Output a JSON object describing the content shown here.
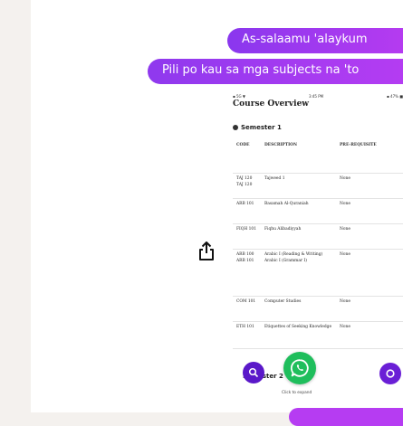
{
  "messages": {
    "m1": "As-salaamu 'alaykum",
    "m2": "Pili po kau sa mga subjects na 'to",
    "m3": ""
  },
  "doc": {
    "status_left": "▪ 5G ▼",
    "status_time": "3:45 PM",
    "status_right": "▪ 47% ■",
    "title": "Course Overview",
    "semester": "Semester 1",
    "headers": [
      "CODE",
      "DESCRIPTION",
      "PRE-REQUISITE"
    ],
    "rows": [
      [
        "TAJ 120 TAJ 120",
        "Tajweed 1",
        "None"
      ],
      [
        "ARB 101",
        "Basamah Al-Quraniah",
        "None"
      ],
      [
        "FIQH 101",
        "Fiqhu Alibadiyyah",
        "None"
      ],
      [
        "ARB 100 ARB 101",
        "Arabic I (Reading & Writing) Arabic I (Grammar I)",
        "None"
      ],
      [
        "COM 101",
        "Computer Studies",
        "None"
      ],
      [
        "ETH 101",
        "Etiquettes of Seeking Knowledge",
        "None"
      ]
    ],
    "footer_label": "Semester 2",
    "footnote": "Click to expand"
  },
  "icons": {
    "share": "share-icon",
    "zoom": "zoom-icon",
    "whatsapp": "whatsapp-icon",
    "chat": "chat-icon"
  },
  "colors": {
    "bubble": "#a43af0",
    "whatsapp": "#1fbe5c",
    "accent": "#5a18c9"
  }
}
